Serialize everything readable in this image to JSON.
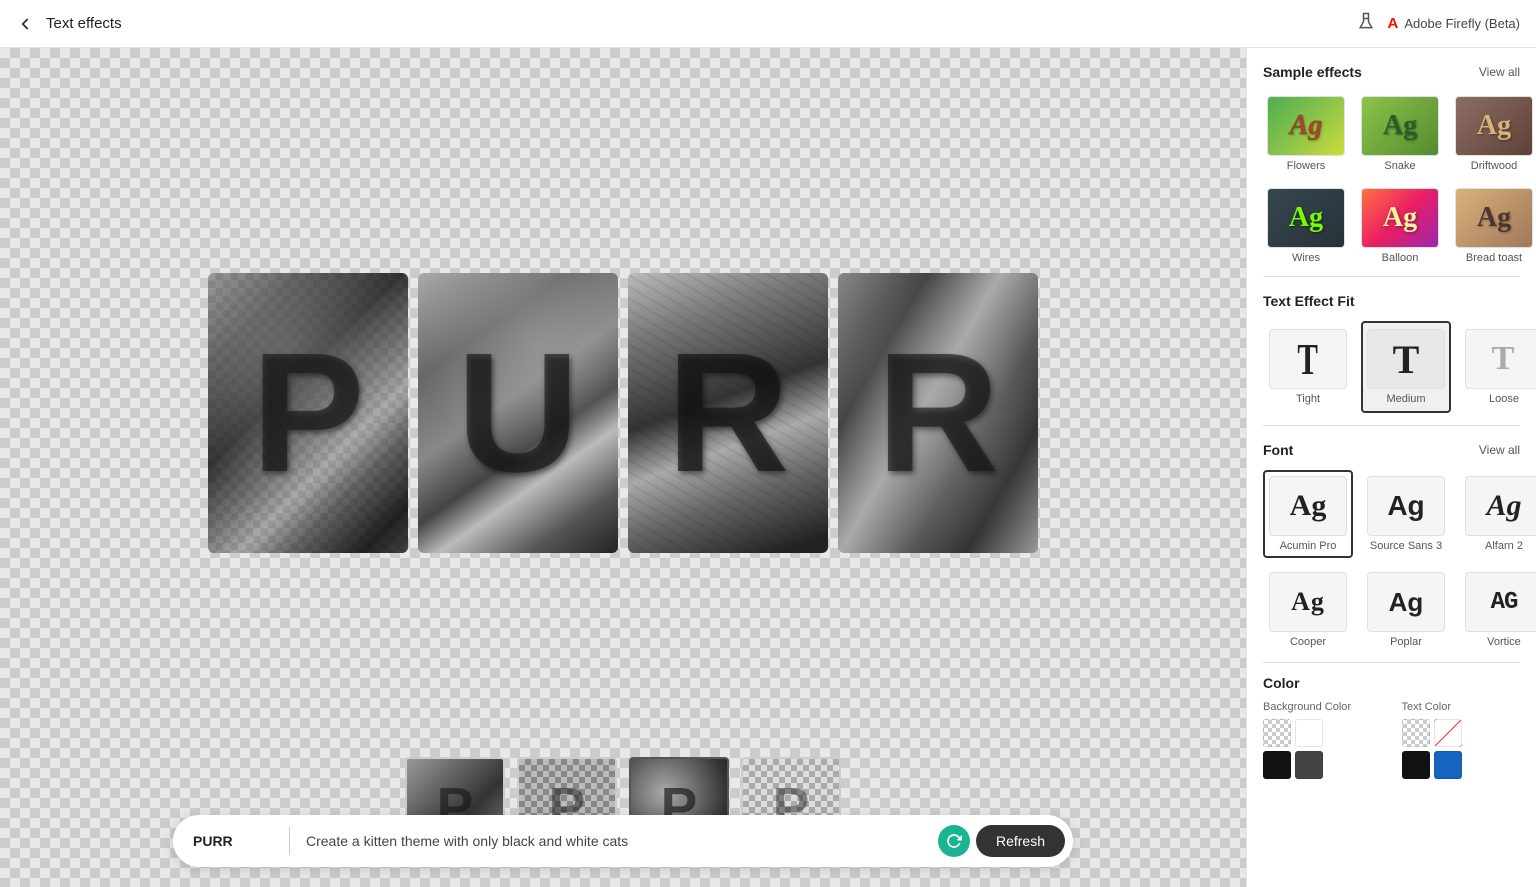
{
  "topbar": {
    "title": "Text effects",
    "back_label": "←",
    "adobe_brand": "Adobe Firefly (Beta)",
    "beaker_symbol": "🧪"
  },
  "canvas": {
    "word": "PURR",
    "description": "Kitten-themed black and white cat pattern letters"
  },
  "prompt": {
    "text_value": "PURR",
    "placeholder": "PURR",
    "description": "Create a kitten theme with only black and white cats",
    "refresh_label": "Refresh"
  },
  "right_panel": {
    "sample_effects": {
      "title": "Sample effects",
      "view_all": "View all",
      "items": [
        {
          "id": "flowers",
          "label": "Flowers",
          "text": "Ag"
        },
        {
          "id": "snake",
          "label": "Snake",
          "text": "Ag"
        },
        {
          "id": "driftwood",
          "label": "Driftwood",
          "text": "Ag"
        },
        {
          "id": "wires",
          "label": "Wires",
          "text": "Ag"
        },
        {
          "id": "balloon",
          "label": "Balloon",
          "text": "Ag"
        },
        {
          "id": "breadtoast",
          "label": "Bread toast",
          "text": "Ag"
        }
      ]
    },
    "text_effect_fit": {
      "title": "Text Effect Fit",
      "items": [
        {
          "id": "tight",
          "label": "Tight"
        },
        {
          "id": "medium",
          "label": "Medium",
          "active": true
        },
        {
          "id": "loose",
          "label": "Loose"
        }
      ]
    },
    "font": {
      "title": "Font",
      "view_all": "View all",
      "items": [
        {
          "id": "acumin",
          "label": "Acumin Pro",
          "text": "Ag",
          "active": true
        },
        {
          "id": "source",
          "label": "Source Sans 3",
          "text": "Ag"
        },
        {
          "id": "alfarn",
          "label": "Alfarn 2",
          "text": "Ag"
        },
        {
          "id": "cooper",
          "label": "Cooper",
          "text": "Ag"
        },
        {
          "id": "poplar",
          "label": "Poplar",
          "text": "Ag"
        },
        {
          "id": "vortice",
          "label": "Vortice",
          "text": "Ag"
        }
      ]
    },
    "color": {
      "title": "Color",
      "background_label": "Background Color",
      "text_label": "Text Color",
      "background_swatches": [
        "transparent",
        "#fff",
        "#f5f5f5",
        "#222",
        "#1565C0"
      ],
      "text_swatches": [
        "transparent",
        "#fff",
        "#e53935",
        "#1565C0",
        "#111"
      ]
    }
  },
  "thumbnails": [
    {
      "id": "thumb1",
      "letter": "P",
      "pattern": "pattern1"
    },
    {
      "id": "thumb2",
      "letter": "P",
      "pattern": "pattern2"
    },
    {
      "id": "thumb3",
      "letter": "P",
      "pattern": "pattern3",
      "active": true
    },
    {
      "id": "thumb4",
      "letter": "P",
      "pattern": "pattern4"
    }
  ]
}
